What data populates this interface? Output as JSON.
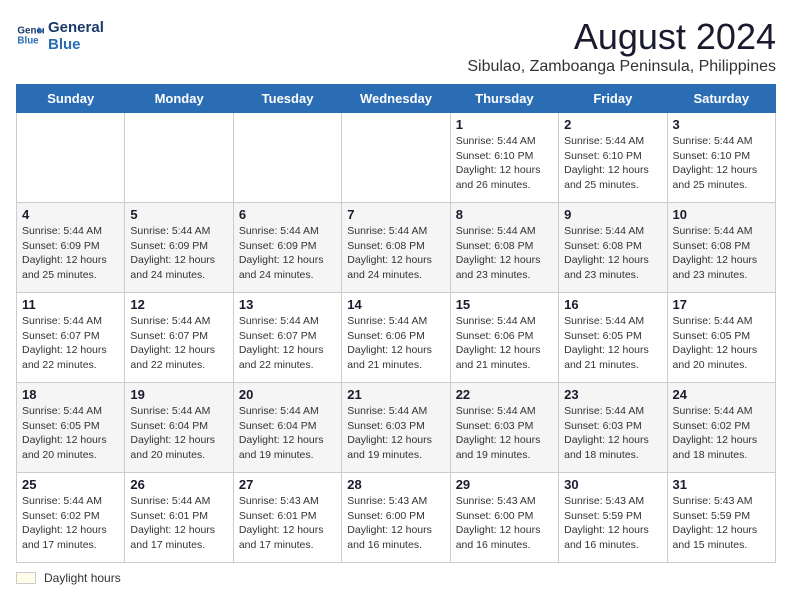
{
  "logo": {
    "line1": "General",
    "line2": "Blue"
  },
  "title": "August 2024",
  "subtitle": "Sibulao, Zamboanga Peninsula, Philippines",
  "days_of_week": [
    "Sunday",
    "Monday",
    "Tuesday",
    "Wednesday",
    "Thursday",
    "Friday",
    "Saturday"
  ],
  "legend_label": "Daylight hours",
  "weeks": [
    [
      {
        "day": "",
        "info": ""
      },
      {
        "day": "",
        "info": ""
      },
      {
        "day": "",
        "info": ""
      },
      {
        "day": "",
        "info": ""
      },
      {
        "day": "1",
        "info": "Sunrise: 5:44 AM\nSunset: 6:10 PM\nDaylight: 12 hours\nand 26 minutes."
      },
      {
        "day": "2",
        "info": "Sunrise: 5:44 AM\nSunset: 6:10 PM\nDaylight: 12 hours\nand 25 minutes."
      },
      {
        "day": "3",
        "info": "Sunrise: 5:44 AM\nSunset: 6:10 PM\nDaylight: 12 hours\nand 25 minutes."
      }
    ],
    [
      {
        "day": "4",
        "info": "Sunrise: 5:44 AM\nSunset: 6:09 PM\nDaylight: 12 hours\nand 25 minutes."
      },
      {
        "day": "5",
        "info": "Sunrise: 5:44 AM\nSunset: 6:09 PM\nDaylight: 12 hours\nand 24 minutes."
      },
      {
        "day": "6",
        "info": "Sunrise: 5:44 AM\nSunset: 6:09 PM\nDaylight: 12 hours\nand 24 minutes."
      },
      {
        "day": "7",
        "info": "Sunrise: 5:44 AM\nSunset: 6:08 PM\nDaylight: 12 hours\nand 24 minutes."
      },
      {
        "day": "8",
        "info": "Sunrise: 5:44 AM\nSunset: 6:08 PM\nDaylight: 12 hours\nand 23 minutes."
      },
      {
        "day": "9",
        "info": "Sunrise: 5:44 AM\nSunset: 6:08 PM\nDaylight: 12 hours\nand 23 minutes."
      },
      {
        "day": "10",
        "info": "Sunrise: 5:44 AM\nSunset: 6:08 PM\nDaylight: 12 hours\nand 23 minutes."
      }
    ],
    [
      {
        "day": "11",
        "info": "Sunrise: 5:44 AM\nSunset: 6:07 PM\nDaylight: 12 hours\nand 22 minutes."
      },
      {
        "day": "12",
        "info": "Sunrise: 5:44 AM\nSunset: 6:07 PM\nDaylight: 12 hours\nand 22 minutes."
      },
      {
        "day": "13",
        "info": "Sunrise: 5:44 AM\nSunset: 6:07 PM\nDaylight: 12 hours\nand 22 minutes."
      },
      {
        "day": "14",
        "info": "Sunrise: 5:44 AM\nSunset: 6:06 PM\nDaylight: 12 hours\nand 21 minutes."
      },
      {
        "day": "15",
        "info": "Sunrise: 5:44 AM\nSunset: 6:06 PM\nDaylight: 12 hours\nand 21 minutes."
      },
      {
        "day": "16",
        "info": "Sunrise: 5:44 AM\nSunset: 6:05 PM\nDaylight: 12 hours\nand 21 minutes."
      },
      {
        "day": "17",
        "info": "Sunrise: 5:44 AM\nSunset: 6:05 PM\nDaylight: 12 hours\nand 20 minutes."
      }
    ],
    [
      {
        "day": "18",
        "info": "Sunrise: 5:44 AM\nSunset: 6:05 PM\nDaylight: 12 hours\nand 20 minutes."
      },
      {
        "day": "19",
        "info": "Sunrise: 5:44 AM\nSunset: 6:04 PM\nDaylight: 12 hours\nand 20 minutes."
      },
      {
        "day": "20",
        "info": "Sunrise: 5:44 AM\nSunset: 6:04 PM\nDaylight: 12 hours\nand 19 minutes."
      },
      {
        "day": "21",
        "info": "Sunrise: 5:44 AM\nSunset: 6:03 PM\nDaylight: 12 hours\nand 19 minutes."
      },
      {
        "day": "22",
        "info": "Sunrise: 5:44 AM\nSunset: 6:03 PM\nDaylight: 12 hours\nand 19 minutes."
      },
      {
        "day": "23",
        "info": "Sunrise: 5:44 AM\nSunset: 6:03 PM\nDaylight: 12 hours\nand 18 minutes."
      },
      {
        "day": "24",
        "info": "Sunrise: 5:44 AM\nSunset: 6:02 PM\nDaylight: 12 hours\nand 18 minutes."
      }
    ],
    [
      {
        "day": "25",
        "info": "Sunrise: 5:44 AM\nSunset: 6:02 PM\nDaylight: 12 hours\nand 17 minutes."
      },
      {
        "day": "26",
        "info": "Sunrise: 5:44 AM\nSunset: 6:01 PM\nDaylight: 12 hours\nand 17 minutes."
      },
      {
        "day": "27",
        "info": "Sunrise: 5:43 AM\nSunset: 6:01 PM\nDaylight: 12 hours\nand 17 minutes."
      },
      {
        "day": "28",
        "info": "Sunrise: 5:43 AM\nSunset: 6:00 PM\nDaylight: 12 hours\nand 16 minutes."
      },
      {
        "day": "29",
        "info": "Sunrise: 5:43 AM\nSunset: 6:00 PM\nDaylight: 12 hours\nand 16 minutes."
      },
      {
        "day": "30",
        "info": "Sunrise: 5:43 AM\nSunset: 5:59 PM\nDaylight: 12 hours\nand 16 minutes."
      },
      {
        "day": "31",
        "info": "Sunrise: 5:43 AM\nSunset: 5:59 PM\nDaylight: 12 hours\nand 15 minutes."
      }
    ]
  ]
}
